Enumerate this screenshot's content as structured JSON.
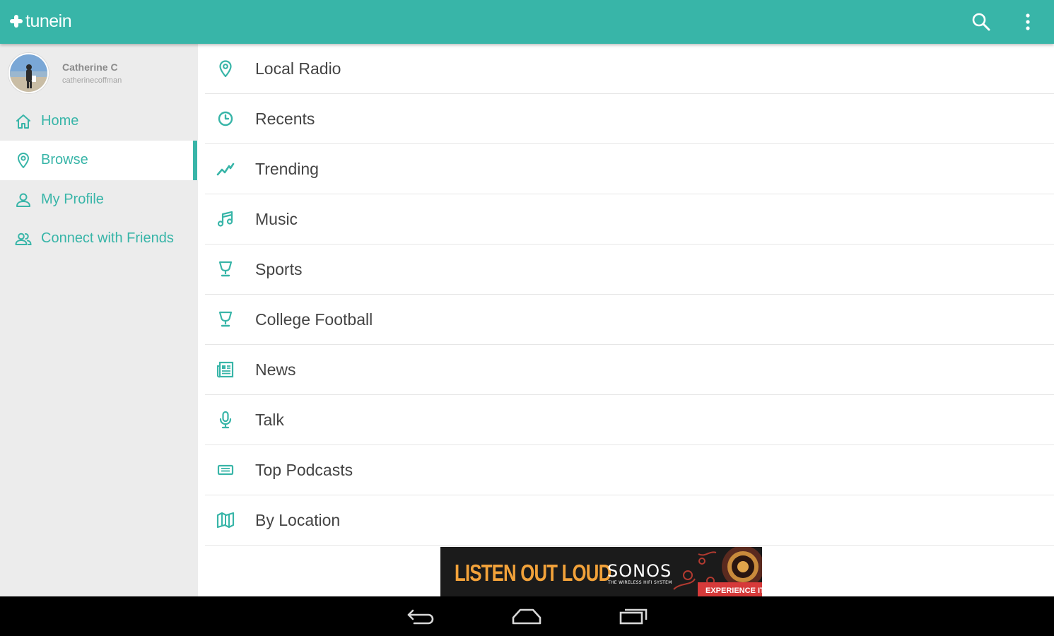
{
  "app": {
    "logo_text": "tunein",
    "accent_color": "#38b5a8"
  },
  "toolbar": {
    "search_icon": "search-icon",
    "overflow_icon": "more-vert-icon"
  },
  "drawer": {
    "user": {
      "name": "Catherine C",
      "handle": "catherinecoffman"
    },
    "items": [
      {
        "label": "Home",
        "icon": "home-icon",
        "active": false
      },
      {
        "label": "Browse",
        "icon": "location-pin-icon",
        "active": true
      },
      {
        "label": "My Profile",
        "icon": "person-icon",
        "active": false
      },
      {
        "label": "Connect with Friends",
        "icon": "people-icon",
        "active": false
      }
    ]
  },
  "browse": {
    "items": [
      {
        "label": "Local Radio",
        "icon": "location-pin-icon"
      },
      {
        "label": "Recents",
        "icon": "clock-icon"
      },
      {
        "label": "Trending",
        "icon": "trending-icon"
      },
      {
        "label": "Music",
        "icon": "music-note-icon"
      },
      {
        "label": "Sports",
        "icon": "trophy-icon"
      },
      {
        "label": "College Football",
        "icon": "trophy-icon"
      },
      {
        "label": "News",
        "icon": "newspaper-icon"
      },
      {
        "label": "Talk",
        "icon": "microphone-icon"
      },
      {
        "label": "Top Podcasts",
        "icon": "podcast-icon"
      },
      {
        "label": "By Location",
        "icon": "map-icon"
      }
    ]
  },
  "ad": {
    "headline": "LISTEN OUT LOUD",
    "brand": "SONOS",
    "tagline": "THE WIRELESS HIFI SYSTEM",
    "cta": "EXPERIENCE IT ›",
    "headline_color": "#f2a23a",
    "cta_color": "#d63a3a"
  },
  "system_nav": {
    "back_icon": "back-icon",
    "home_icon": "home-outline-icon",
    "recents_icon": "recents-icon"
  }
}
